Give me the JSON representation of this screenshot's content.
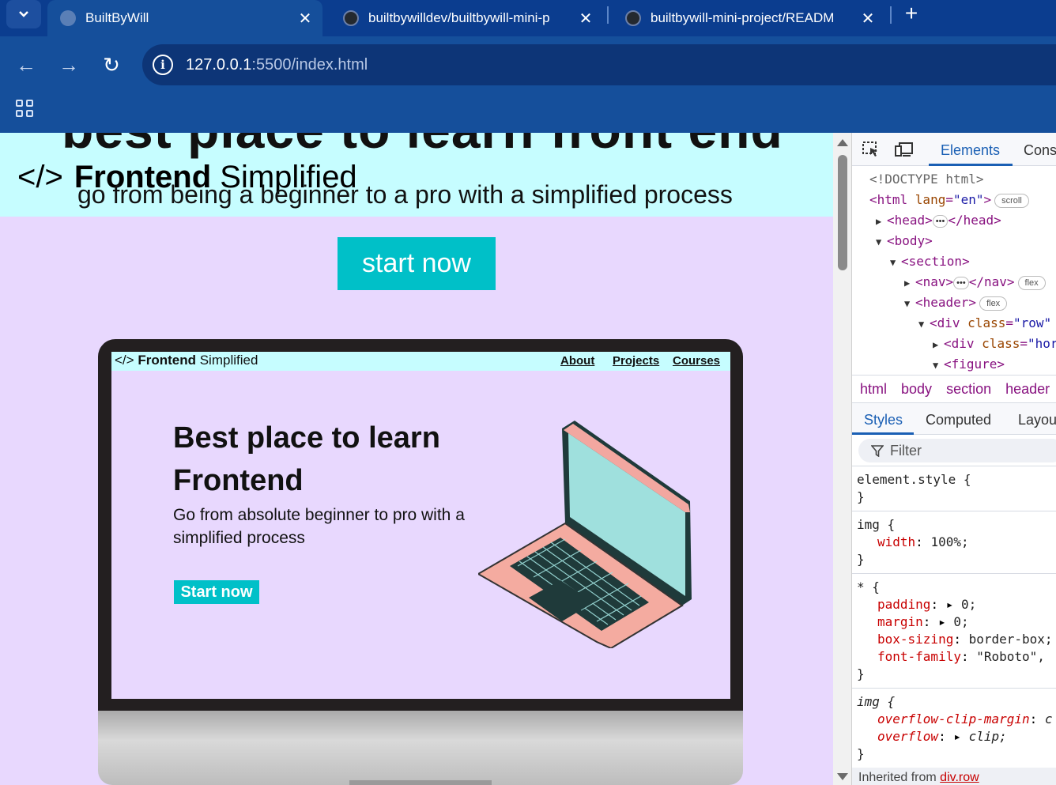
{
  "browser": {
    "tabs": [
      {
        "label": "BuiltByWill",
        "active": true
      },
      {
        "label": "builtbywilldev/builtbywill-mini-p",
        "active": false
      },
      {
        "label": "builtbywill-mini-project/READM",
        "active": false
      }
    ],
    "url_host": "127.0.0.1",
    "url_path": ":5500/index.html"
  },
  "page": {
    "hero_cut_text": "best place to learn front end",
    "logo_code": "</>",
    "logo_bold": "Frontend",
    "logo_light": "Simplified",
    "subtitle": "go from being a beginner to a pro with a simplified process",
    "cta_label": "start now",
    "screen": {
      "logo_code": "</>",
      "logo_bold": "Frontend",
      "logo_light": "Simplified",
      "nav_links": [
        "About",
        "Projects",
        "Courses"
      ],
      "title": "Best place to learn Frontend",
      "subtitle": "Go from absolute beginner to pro with a simplified process",
      "button": "Start now"
    }
  },
  "devtools": {
    "tabs": [
      "Elements",
      "Cons"
    ],
    "dom": {
      "doctype": "<!DOCTYPE html>",
      "html_open": "<html ",
      "html_attr": "lang",
      "html_val": "\"en\"",
      "html_pill": "scroll",
      "head_open": "<head>",
      "head_close": "</head>",
      "body_open": "<body>",
      "section_open": "<section>",
      "nav_open": "<nav>",
      "nav_close": "</nav>",
      "nav_pill": "flex",
      "header_open": "<header>",
      "header_pill": "flex",
      "div_row_open": "<div ",
      "div_row_attr": "class",
      "div_row_val": "\"row\"",
      "div_hor_open": "<div ",
      "div_hor_attr": "class",
      "div_hor_val": "\"hor",
      "figure_open": "<figure>"
    },
    "breadcrumbs": [
      "html",
      "body",
      "section",
      "header"
    ],
    "subtabs": [
      "Styles",
      "Computed",
      "Layou"
    ],
    "filter_placeholder": "Filter",
    "styles": {
      "r1_sel": "element.style {",
      "r1_close": "}",
      "r2_sel": "img {",
      "r2_p1_name": "width",
      "r2_p1_val": "100%;",
      "r2_close": "}",
      "r3_sel": "* {",
      "r3_p1_name": "padding",
      "r3_p1_val": "0;",
      "r3_p2_name": "margin",
      "r3_p2_val": "0;",
      "r3_p3_name": "box-sizing",
      "r3_p3_val": "border-box;",
      "r3_p4_name": "font-family",
      "r3_p4_val": "\"Roboto\",",
      "r3_close": "}",
      "r4_sel": "img {",
      "r4_p1_name": "overflow-clip-margin",
      "r4_p1_val": "c",
      "r4_p2_name": "overflow",
      "r4_p2_val": "clip;",
      "r4_close": "}"
    },
    "inherited_label": "Inherited from",
    "inherited_target": "div.row"
  },
  "colors": {
    "chrome_dark": "#0b3d8f",
    "chrome_toolbar": "#154f9b",
    "page_bg": "#e8d8fe",
    "banner_bg": "#c6fdff",
    "accent_cyan": "#00c0c8"
  }
}
